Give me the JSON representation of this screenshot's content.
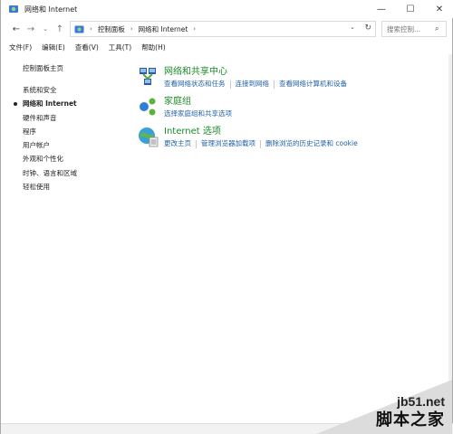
{
  "window": {
    "title": "网络和 Internet",
    "controls": {
      "minimize": "—",
      "maximize": "☐",
      "close": "✕"
    }
  },
  "address": {
    "breadcrumb": [
      "控制面板",
      "网络和 Internet"
    ],
    "search_placeholder": "搜索控制..."
  },
  "menu": [
    "文件(F)",
    "编辑(E)",
    "查看(V)",
    "工具(T)",
    "帮助(H)"
  ],
  "left_nav": {
    "home": "控制面板主页",
    "items": [
      {
        "label": "系统和安全",
        "active": false
      },
      {
        "label": "网络和 Internet",
        "active": true
      },
      {
        "label": "硬件和声音",
        "active": false
      },
      {
        "label": "程序",
        "active": false
      },
      {
        "label": "用户帐户",
        "active": false
      },
      {
        "label": "外观和个性化",
        "active": false
      },
      {
        "label": "时钟、语言和区域",
        "active": false
      },
      {
        "label": "轻松使用",
        "active": false
      }
    ]
  },
  "categories": [
    {
      "title": "网络和共享中心",
      "icon": "network-sharing-icon",
      "links": [
        "查看网络状态和任务",
        "连接到网络",
        "查看网络计算机和设备"
      ]
    },
    {
      "title": "家庭组",
      "icon": "homegroup-icon",
      "links": [
        "选择家庭组和共享选项"
      ]
    },
    {
      "title": "Internet 选项",
      "icon": "internet-options-icon",
      "links": [
        "更改主页",
        "管理浏览器加载项",
        "删除浏览的历史记录和 cookie"
      ]
    }
  ],
  "watermark": {
    "site": "jb51.net",
    "name": "脚本之家"
  },
  "colors": {
    "category_title": "#1b8b2a",
    "link": "#2161a8"
  }
}
